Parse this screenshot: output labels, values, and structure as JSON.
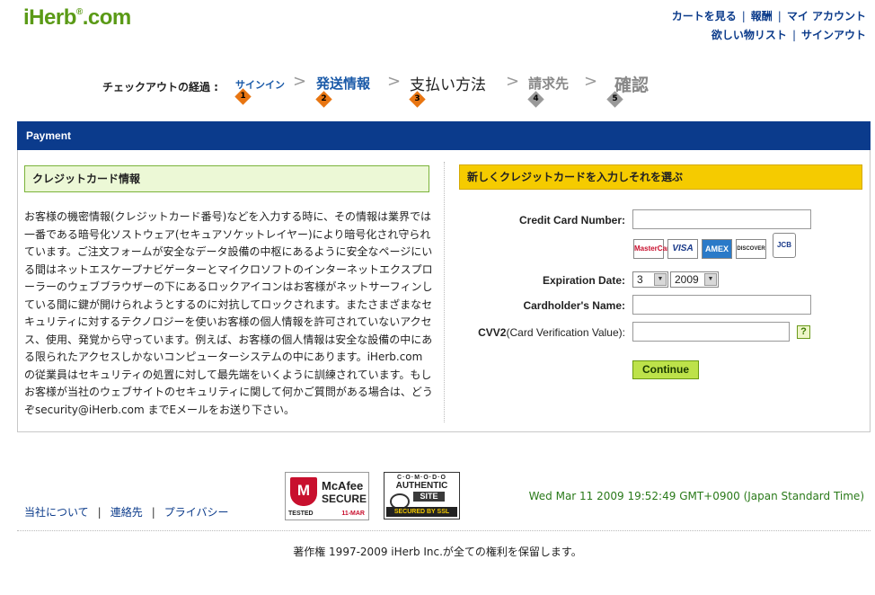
{
  "logo": {
    "text": "iHerb",
    "reg": "®",
    "tld": ".com"
  },
  "toplinks": {
    "view_cart": "カートを見る",
    "rewards": "報酬",
    "my_account": "マイ アカウント",
    "wishlist": "欲しい物リスト",
    "sign_out": "サインアウト"
  },
  "checkout_steps": {
    "label": "チェックアウトの経過 :",
    "steps": [
      {
        "label": "サインイン",
        "number": "1",
        "state": "done"
      },
      {
        "label": "発送情報",
        "number": "2",
        "state": "done"
      },
      {
        "label": "支払い方法",
        "number": "3",
        "state": "current"
      },
      {
        "label": "請求先",
        "number": "4",
        "state": "pending"
      },
      {
        "label": "確認",
        "number": "5",
        "state": "pending"
      }
    ],
    "separator": ">",
    "colors": {
      "done": "#1a5aa8",
      "current": "#222222",
      "pending": "#888888",
      "done_badge": "#e87511",
      "pending_badge": "#999999"
    }
  },
  "section_title": "Payment",
  "left_panel": {
    "title": "クレジットカード情報",
    "body": "お客様の機密情報(クレジットカード番号)などを入力する時に、その情報は業界では一番である暗号化ソストウェア(セキュアソケットレイヤー)により暗号化され守られています。ご注文フォームが安全なデータ設備の中枢にあるように安全なページにいる間はネットエスケープナビゲーターとマイクロソフトのインターネットエクスプローラーのウェブブラウザーの下にあるロックアイコンはお客様がネットサーフィンしている間に鍵が開けられようとするのに対抗してロックされます。またさまざまなセキュリティに対するテクノロジーを使いお客様の個人情報を許可されていないアクセス、使用、発覚から守っています。例えば、お客様の個人情報は安全な設備の中にある限られたアクセスしかないコンピューターシステムの中にあります。iHerb.comの従業員はセキュリティの処置に対して最先端をいくように訓練されています。もしお客様が当社のウェブサイトのセキュリティに関して何かご質問がある場合は、どうぞsecurity@iHerb.com までEメールをお送り下さい。"
  },
  "right_panel": {
    "title": "新しくクレジットカードを入力しそれを選ぶ",
    "cc_number_label": "Credit Card Number:",
    "cc_number_value": "",
    "card_logos": [
      "MasterCard",
      "VISA",
      "AMEX",
      "DISCOVER",
      "JCB"
    ],
    "expiration_label": "Expiration Date:",
    "exp_month": "3",
    "exp_year": "2009",
    "cardholder_label": "Cardholder's Name:",
    "cardholder_value": "",
    "cvv_label_bold": "CVV2",
    "cvv_label_rest": "(Card Verification Value):",
    "cvv_value": "",
    "help_symbol": "?",
    "continue_label": "Continue"
  },
  "footer": {
    "links": [
      "当社について",
      "連絡先",
      "プライバシー"
    ],
    "mcafee": {
      "brand": "McAfee",
      "secure": "SECURE",
      "tested": "TESTED",
      "date": "11-MAR"
    },
    "comodo": {
      "top": "C·O·M·O·D·O",
      "line1": "AUTHENTIC",
      "line2": "SITE",
      "bottom": "SECURED BY SSL"
    },
    "datetime": "Wed Mar 11 2009 19:52:49 GMT+0900 (Japan Standard Time)",
    "copyright": "著作権  1997-2009 iHerb Inc.が全ての権利を保留します。"
  }
}
